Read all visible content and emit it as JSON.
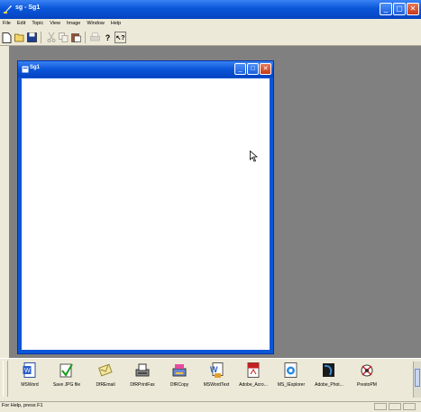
{
  "app": {
    "title": "sg - Sg1"
  },
  "menu": [
    "File",
    "Edit",
    "Topic",
    "View",
    "Image",
    "Window",
    "Help"
  ],
  "toolbar": {
    "items": [
      {
        "name": "new",
        "icon": "new-document-icon",
        "enabled": true
      },
      {
        "name": "open",
        "icon": "open-folder-icon",
        "enabled": true
      },
      {
        "name": "save",
        "icon": "save-disk-icon",
        "enabled": true
      },
      {
        "name": "cut",
        "icon": "cut-icon",
        "enabled": false
      },
      {
        "name": "copy",
        "icon": "copy-icon",
        "enabled": false
      },
      {
        "name": "paste",
        "icon": "paste-icon",
        "enabled": true
      },
      {
        "name": "print",
        "icon": "print-icon",
        "enabled": false
      },
      {
        "name": "help",
        "icon": "help-icon",
        "enabled": true
      },
      {
        "name": "context-help",
        "icon": "context-help-icon",
        "enabled": true
      }
    ]
  },
  "child_window": {
    "title": "Sg1"
  },
  "launcher": {
    "items": [
      {
        "label": "MSWord",
        "icon": "word-document-icon"
      },
      {
        "label": "Save JPG file",
        "icon": "save-jpg-icon"
      },
      {
        "label": "DfREmail",
        "icon": "email-icon"
      },
      {
        "label": "DfRPrintFax",
        "icon": "print-fax-icon"
      },
      {
        "label": "DfRCopy",
        "icon": "copy-machine-icon"
      },
      {
        "label": "MSWordText",
        "icon": "word-text-icon"
      },
      {
        "label": "Adobe_Acro...",
        "icon": "acrobat-icon"
      },
      {
        "label": "MS_IExplorer",
        "icon": "internet-explorer-icon"
      },
      {
        "label": "Adobe_Phot...",
        "icon": "photoshop-icon"
      },
      {
        "label": "PrestoPM",
        "icon": "prestopm-icon"
      }
    ]
  },
  "status": {
    "text": "For Help, press F1"
  }
}
